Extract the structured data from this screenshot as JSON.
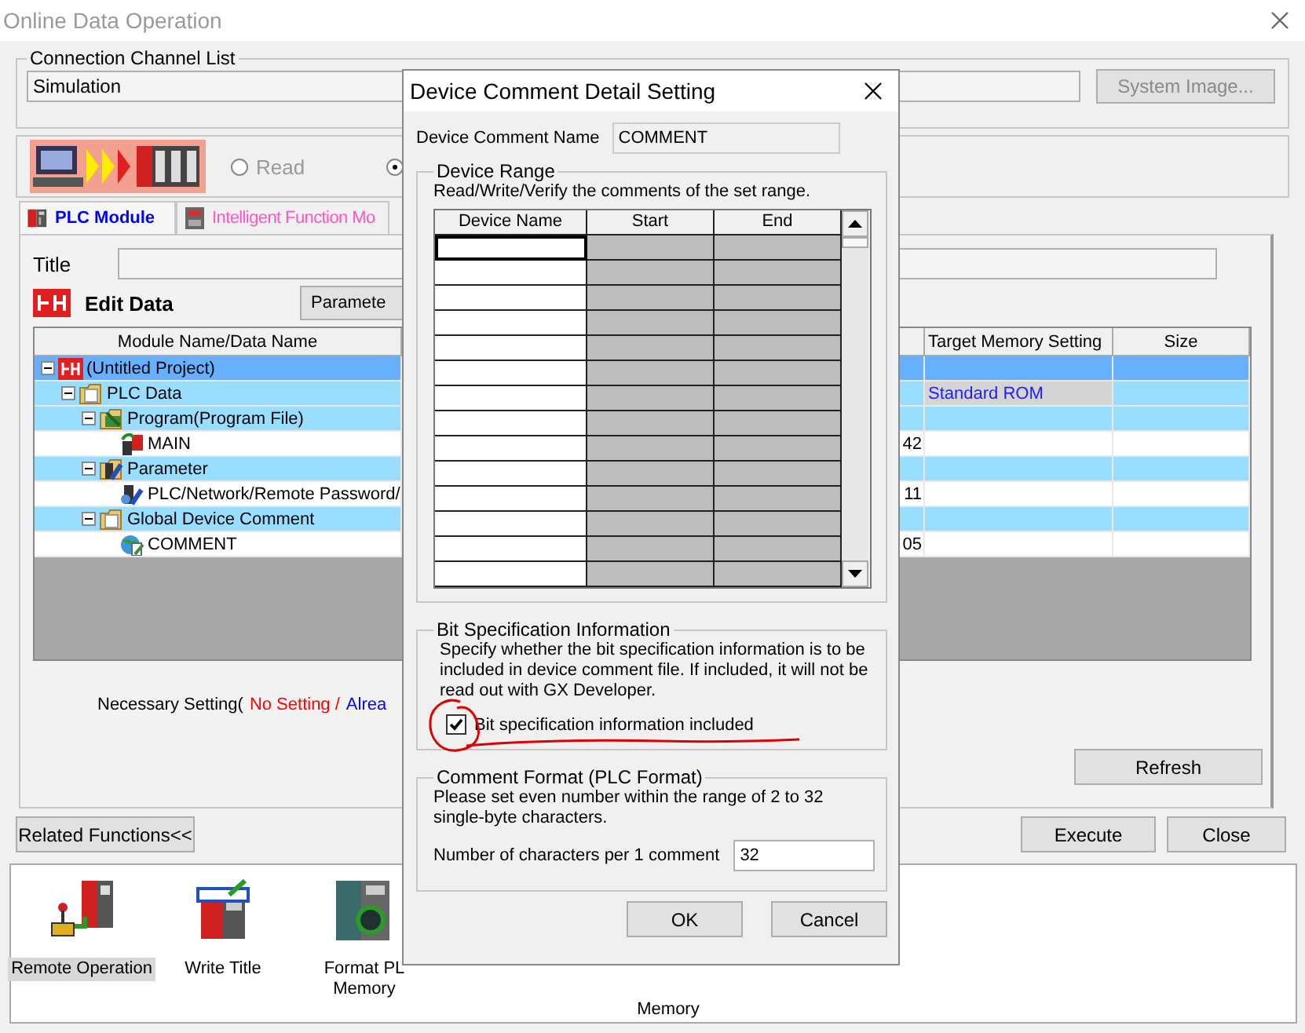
{
  "window": {
    "title": "Online Data Operation"
  },
  "connection": {
    "legend": "Connection Channel List",
    "value": "Simulation",
    "button": {
      "label": "System Image...",
      "disabled": true
    }
  },
  "direction": {
    "options": [
      {
        "label": "Read",
        "selected": false
      },
      {
        "selected": true
      }
    ]
  },
  "tabs": [
    {
      "label": "PLC Module",
      "selected": true,
      "kind": "plc"
    },
    {
      "label": "Intelligent Function Mo",
      "selected": false,
      "kind": "module"
    }
  ],
  "title_field": {
    "label": "Title"
  },
  "edit_data": {
    "label": "Edit Data",
    "button": "Paramete"
  },
  "table": {
    "columns": [
      "Module Name/Data Name",
      "Target Memory Setting",
      "Size"
    ],
    "rows": [
      {
        "name": "(Untitled Project)",
        "kind": "project",
        "selected": true,
        "expanded": true,
        "children": [
          {
            "name": "PLC Data",
            "kind": "folder",
            "selected": false,
            "expanded": true,
            "target": "Standard ROM",
            "children": [
              {
                "name": "Program(Program File)",
                "kind": "program",
                "selected": false,
                "expanded": true,
                "children": [
                  {
                    "name": "MAIN",
                    "kind": "file",
                    "selected": false,
                    "column_2": "42"
                  }
                ]
              },
              {
                "name": "Parameter",
                "kind": "parameter",
                "selected": false,
                "expanded": true,
                "children": [
                  {
                    "name": "PLC/Network/Remote Password/",
                    "kind": "param-file",
                    "selected": false,
                    "column_2": "11"
                  }
                ]
              },
              {
                "name": "Global Device Comment",
                "kind": "folder",
                "selected": false,
                "expanded": true,
                "children": [
                  {
                    "name": "COMMENT",
                    "kind": "comment",
                    "selected": false,
                    "column_2": "05"
                  }
                ]
              }
            ]
          }
        ]
      }
    ]
  },
  "necessary_setting": [
    {
      "text": "Necessary Setting(",
      "color": "#000000"
    },
    {
      "text": "No Setting /",
      "color": "#ff0000"
    },
    {
      "text": "Alrea",
      "color": "#0000ff"
    }
  ],
  "refresh": "Refresh",
  "related_button": "Related Functions<<",
  "execute": "Execute",
  "close": "Close",
  "related_functions": [
    {
      "kind": "remote",
      "label": [
        "Remote Operation"
      ],
      "selected": true
    },
    {
      "kind": "write-title",
      "label": [
        "Write Title"
      ],
      "selected": false
    },
    {
      "kind": "format",
      "label": [
        "Format PL",
        "Memory"
      ],
      "selected": false
    },
    {
      "kind": "covered"
    },
    {
      "kind": "covered",
      "label": [
        "Memory"
      ],
      "selected": false
    }
  ],
  "dialog": {
    "title": "Device Comment Detail Setting",
    "name_label": "Device Comment Name",
    "name_value": "COMMENT",
    "range": {
      "legend": "Device Range",
      "hint": "Read/Write/Verify the comments of the set range.",
      "columns": [
        "Device Name",
        "Start",
        "End"
      ],
      "rows": [
        {
          "selected": true
        },
        {
          "selected": false
        },
        {
          "selected": false
        },
        {
          "selected": false
        },
        {
          "selected": false
        },
        {
          "selected": false
        },
        {
          "selected": false
        },
        {
          "selected": false
        },
        {
          "selected": false
        },
        {
          "selected": false
        },
        {
          "selected": false
        },
        {
          "selected": false
        },
        {
          "selected": false
        },
        {
          "selected": false
        }
      ]
    },
    "bit_spec": {
      "legend": "Bit Specification Information",
      "text": "Specify whether the bit specification information is to be included in device comment file. If included, it will not be read out with GX Developer.",
      "checkbox": {
        "label": "Bit specification information included",
        "checked": true
      }
    },
    "format": {
      "legend": "Comment Format (PLC Format)",
      "text": "Please set even number within the range of 2 to 32 single-byte characters.",
      "field_label": "Number of characters per 1 comment",
      "value": "32"
    },
    "buttons": [
      "OK",
      "Cancel"
    ]
  },
  "annotations": {
    "circle": true,
    "underline": true
  }
}
